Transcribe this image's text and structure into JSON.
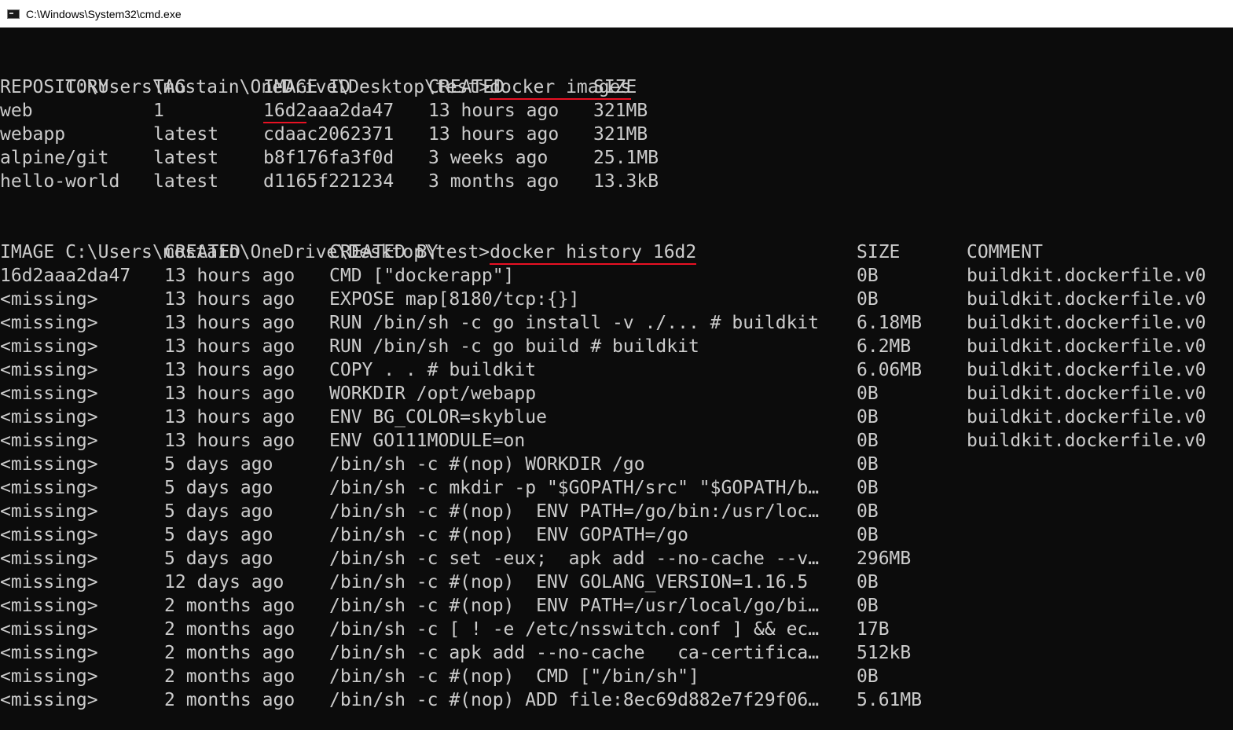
{
  "window": {
    "title": "C:\\Windows\\System32\\cmd.exe",
    "icon": "cmd-icon"
  },
  "colors": {
    "background": "#0c0c0c",
    "text": "#cccccc",
    "annotation": "#e81123"
  },
  "session1": {
    "prompt": "C:\\Users\\mostain\\OneDrive\\Desktop\\test>",
    "command": "docker images",
    "headers": [
      "REPOSITORY",
      "TAG",
      "IMAGE ID",
      "CREATED",
      "SIZE"
    ],
    "rows": [
      [
        "web",
        "1",
        "16d2aaa2da47",
        "13 hours ago",
        "321MB"
      ],
      [
        "webapp",
        "latest",
        "cdaac2062371",
        "13 hours ago",
        "321MB"
      ],
      [
        "alpine/git",
        "latest",
        "b8f176fa3f0d",
        "3 weeks ago",
        "25.1MB"
      ],
      [
        "hello-world",
        "latest",
        "d1165f221234",
        "3 months ago",
        "13.3kB"
      ]
    ],
    "highlighted_id_prefix": "16d2",
    "highlighted_id_rest": "aaa2da47"
  },
  "session2": {
    "prompt": "C:\\Users\\mostain\\OneDrive\\Desktop\\test>",
    "command": "docker history 16d2",
    "headers": [
      "IMAGE",
      "CREATED",
      "CREATED BY",
      "SIZE",
      "COMMENT"
    ],
    "rows": [
      [
        "16d2aaa2da47",
        "13 hours ago",
        "CMD [\"dockerapp\"]",
        "0B",
        "buildkit.dockerfile.v0"
      ],
      [
        "<missing>",
        "13 hours ago",
        "EXPOSE map[8180/tcp:{}]",
        "0B",
        "buildkit.dockerfile.v0"
      ],
      [
        "<missing>",
        "13 hours ago",
        "RUN /bin/sh -c go install -v ./... # buildkit",
        "6.18MB",
        "buildkit.dockerfile.v0"
      ],
      [
        "<missing>",
        "13 hours ago",
        "RUN /bin/sh -c go build # buildkit",
        "6.2MB",
        "buildkit.dockerfile.v0"
      ],
      [
        "<missing>",
        "13 hours ago",
        "COPY . . # buildkit",
        "6.06MB",
        "buildkit.dockerfile.v0"
      ],
      [
        "<missing>",
        "13 hours ago",
        "WORKDIR /opt/webapp",
        "0B",
        "buildkit.dockerfile.v0"
      ],
      [
        "<missing>",
        "13 hours ago",
        "ENV BG_COLOR=skyblue",
        "0B",
        "buildkit.dockerfile.v0"
      ],
      [
        "<missing>",
        "13 hours ago",
        "ENV GO111MODULE=on",
        "0B",
        "buildkit.dockerfile.v0"
      ],
      [
        "<missing>",
        "5 days ago",
        "/bin/sh -c #(nop) WORKDIR /go",
        "0B",
        ""
      ],
      [
        "<missing>",
        "5 days ago",
        "/bin/sh -c mkdir -p \"$GOPATH/src\" \"$GOPATH/b…",
        "0B",
        ""
      ],
      [
        "<missing>",
        "5 days ago",
        "/bin/sh -c #(nop)  ENV PATH=/go/bin:/usr/loc…",
        "0B",
        ""
      ],
      [
        "<missing>",
        "5 days ago",
        "/bin/sh -c #(nop)  ENV GOPATH=/go",
        "0B",
        ""
      ],
      [
        "<missing>",
        "5 days ago",
        "/bin/sh -c set -eux;  apk add --no-cache --v…",
        "296MB",
        ""
      ],
      [
        "<missing>",
        "12 days ago",
        "/bin/sh -c #(nop)  ENV GOLANG_VERSION=1.16.5",
        "0B",
        ""
      ],
      [
        "<missing>",
        "2 months ago",
        "/bin/sh -c #(nop)  ENV PATH=/usr/local/go/bi…",
        "0B",
        ""
      ],
      [
        "<missing>",
        "2 months ago",
        "/bin/sh -c [ ! -e /etc/nsswitch.conf ] && ec…",
        "17B",
        ""
      ],
      [
        "<missing>",
        "2 months ago",
        "/bin/sh -c apk add --no-cache   ca-certifica…",
        "512kB",
        ""
      ],
      [
        "<missing>",
        "2 months ago",
        "/bin/sh -c #(nop)  CMD [\"/bin/sh\"]",
        "0B",
        ""
      ],
      [
        "<missing>",
        "2 months ago",
        "/bin/sh -c #(nop) ADD file:8ec69d882e7f29f06…",
        "5.61MB",
        ""
      ]
    ]
  }
}
